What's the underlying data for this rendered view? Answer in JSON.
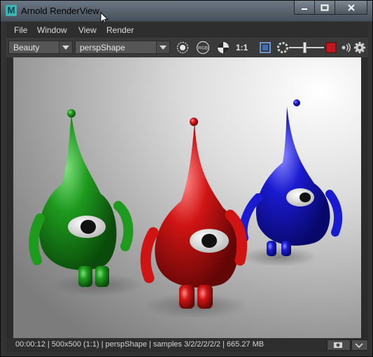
{
  "window": {
    "title": "Arnold RenderView"
  },
  "menu": {
    "items": [
      "File",
      "Window",
      "View",
      "Render"
    ]
  },
  "toolbar": {
    "aov": "Beauty",
    "camera": "perspShape",
    "rgb_label": "RGB",
    "ratio": "1:1",
    "accent_red": "#c0181c"
  },
  "status": {
    "text": "00:00:12 | 500x500 (1:1) | perspShape  | samples 3/2/2/2/2/2 | 665.27 MB"
  },
  "icons": [
    "maya-app-icon",
    "minimize-icon",
    "maximize-icon",
    "close-icon",
    "mouse-cursor-icon",
    "refresh-icon",
    "rgb-channel-icon",
    "checker-icon",
    "crop-region-icon",
    "ipr-icon",
    "stop-icon",
    "dial-icon",
    "gear-icon",
    "snapshot-icon",
    "chevron-down-icon"
  ],
  "render": {
    "subject": [
      "green",
      "red",
      "blue"
    ],
    "colors": {
      "green": "#1e9a1e",
      "red": "#d01414",
      "blue": "#1a1ad0"
    }
  }
}
